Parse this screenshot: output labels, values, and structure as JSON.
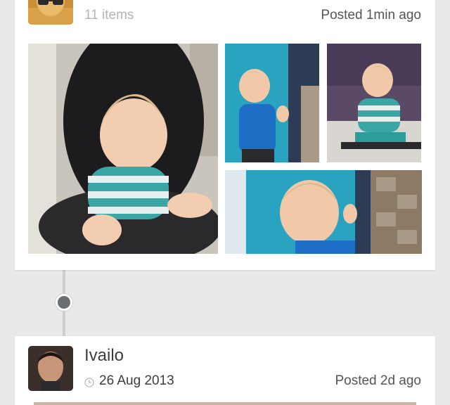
{
  "colors": {
    "background": "#e9e9ea",
    "card": "#ffffff",
    "timeline_node": "#6a6e72",
    "muted_text": "#b5b5b7",
    "text": "#3d3d40"
  },
  "posts": [
    {
      "item_count": "11 items",
      "posted": "Posted 1min ago",
      "avatar_icon": "user-avatar-glasses",
      "photos": [
        {
          "description_icon": "photo-baby-on-chair"
        },
        {
          "description_icon": "photo-baby-at-door"
        },
        {
          "description_icon": "photo-baby-on-stool"
        },
        {
          "description_icon": "photo-baby-closeup-door"
        }
      ]
    },
    {
      "author": "Ivailo",
      "date": "26 Aug 2013",
      "posted": "Posted 2d ago",
      "avatar_icon": "user-avatar-man"
    }
  ]
}
